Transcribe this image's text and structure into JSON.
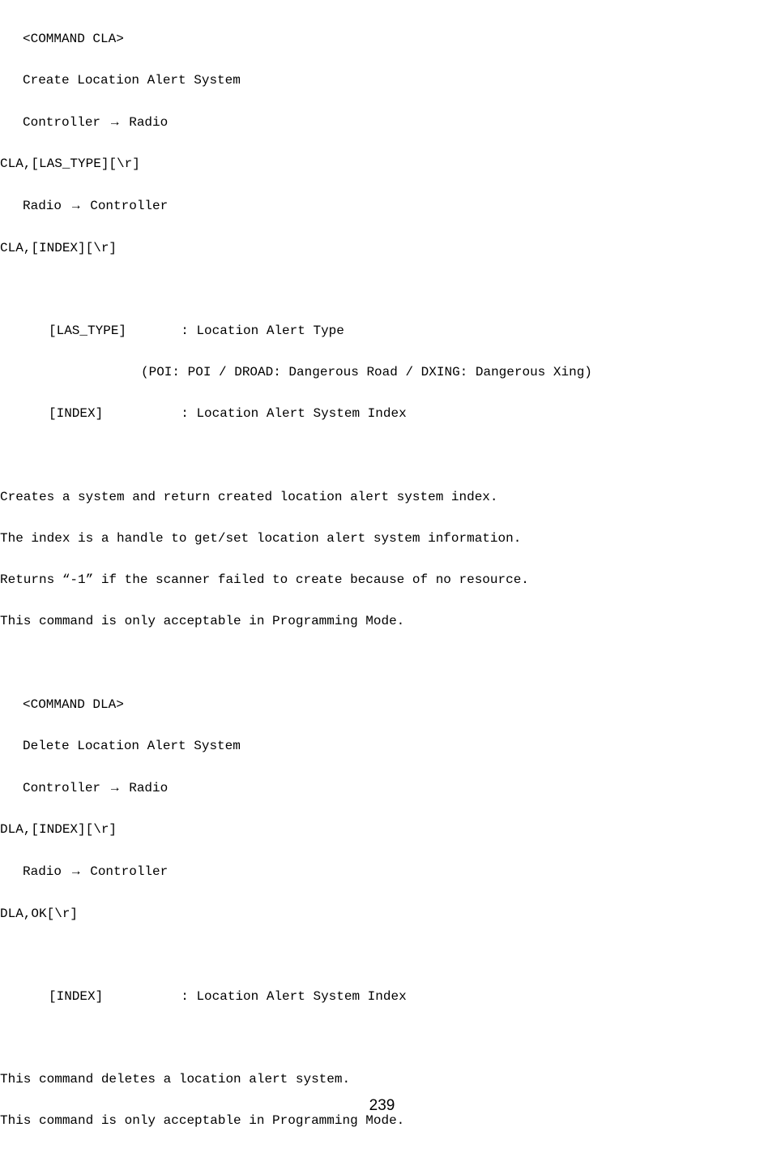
{
  "cla": {
    "header": "<COMMAND CLA>",
    "title": "Create Location Alert System",
    "c2r_label_pre": "Controller ",
    "c2r_label_post": " Radio",
    "c2r_syntax": "CLA,[LAS_TYPE][\\r]",
    "r2c_label_pre": "Radio ",
    "r2c_label_post": " Controller",
    "r2c_syntax": "CLA,[INDEX][\\r]",
    "param1_name": "[LAS_TYPE]",
    "param1_desc": ": Location Alert Type",
    "param1_values": "(POI: POI / DROAD: Dangerous Road / DXING: Dangerous Xing)",
    "param2_name": "[INDEX]",
    "param2_desc": ": Location Alert System Index",
    "desc1": "Creates a system and return created location alert system index.",
    "desc2": "The index is a handle to get/set location alert system information.",
    "desc3": "Returns “-1” if the scanner failed to create because of no resource.",
    "desc4": "This command is only acceptable in Programming Mode."
  },
  "dla": {
    "header": "<COMMAND DLA>",
    "title": "Delete Location Alert System",
    "c2r_label_pre": "Controller ",
    "c2r_label_post": " Radio",
    "c2r_syntax": "DLA,[INDEX][\\r]",
    "r2c_label_pre": "Radio ",
    "r2c_label_post": " Controller",
    "r2c_syntax": "DLA,OK[\\r]",
    "param1_name": "[INDEX]",
    "param1_desc": ": Location Alert System Index",
    "desc1": "This command deletes a location alert system.",
    "desc2": "This command is only acceptable in Programming Mode."
  },
  "arrow": "→",
  "page_number": "239"
}
